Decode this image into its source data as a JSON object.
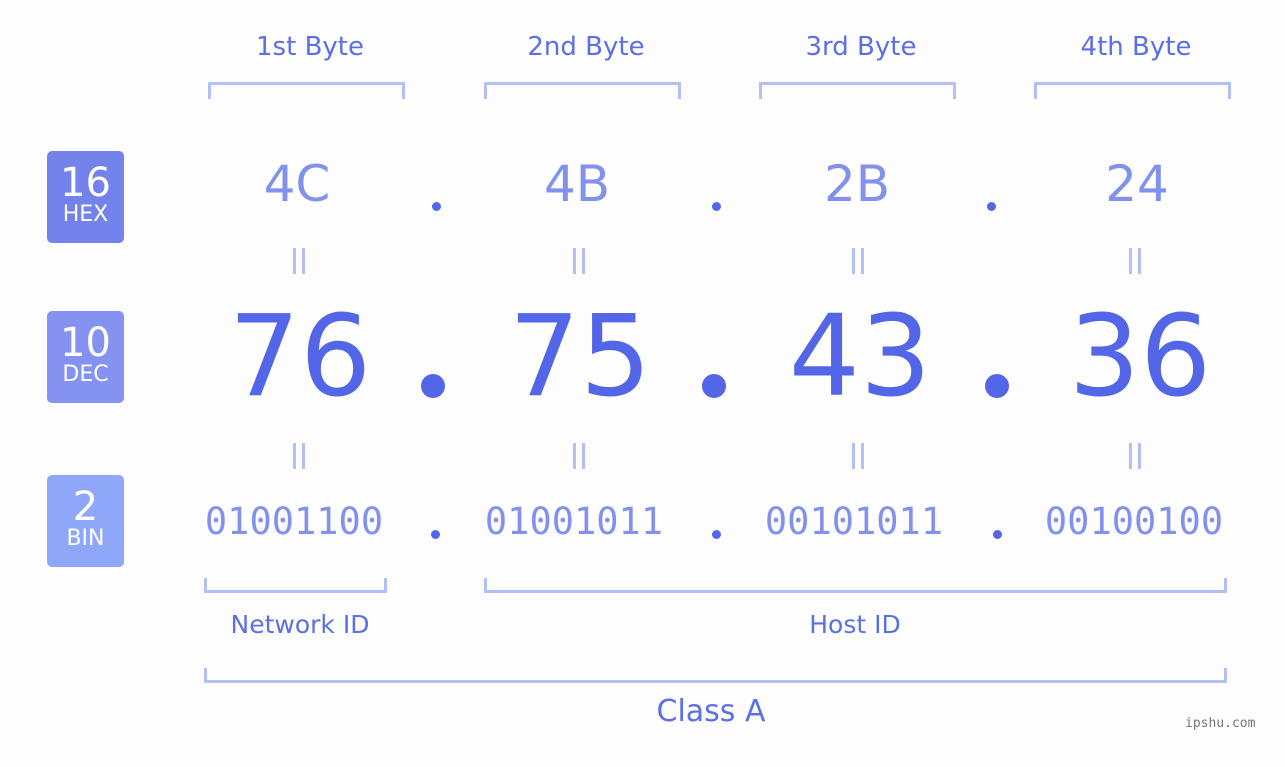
{
  "badges": [
    {
      "num": "16",
      "label": "HEX",
      "color": "#7383eb"
    },
    {
      "num": "10",
      "label": "DEC",
      "color": "#8493f1"
    },
    {
      "num": "2",
      "label": "BIN",
      "color": "#8fa7f8"
    }
  ],
  "bytes": [
    {
      "header": "1st Byte",
      "hex": "4C",
      "dec": "76",
      "bin": "01001100"
    },
    {
      "header": "2nd Byte",
      "hex": "4B",
      "dec": "75",
      "bin": "01001011"
    },
    {
      "header": "3rd Byte",
      "hex": "2B",
      "dec": "43",
      "bin": "00101011"
    },
    {
      "header": "4th Byte",
      "hex": "24",
      "dec": "36",
      "bin": "00100100"
    }
  ],
  "labels": {
    "network_id": "Network ID",
    "host_id": "Host ID",
    "class": "Class A"
  },
  "watermark": "ipshu.com",
  "colors": {
    "accent": "#5366e8",
    "light_accent": "#8391ee",
    "bracket": "#b3bff7"
  }
}
